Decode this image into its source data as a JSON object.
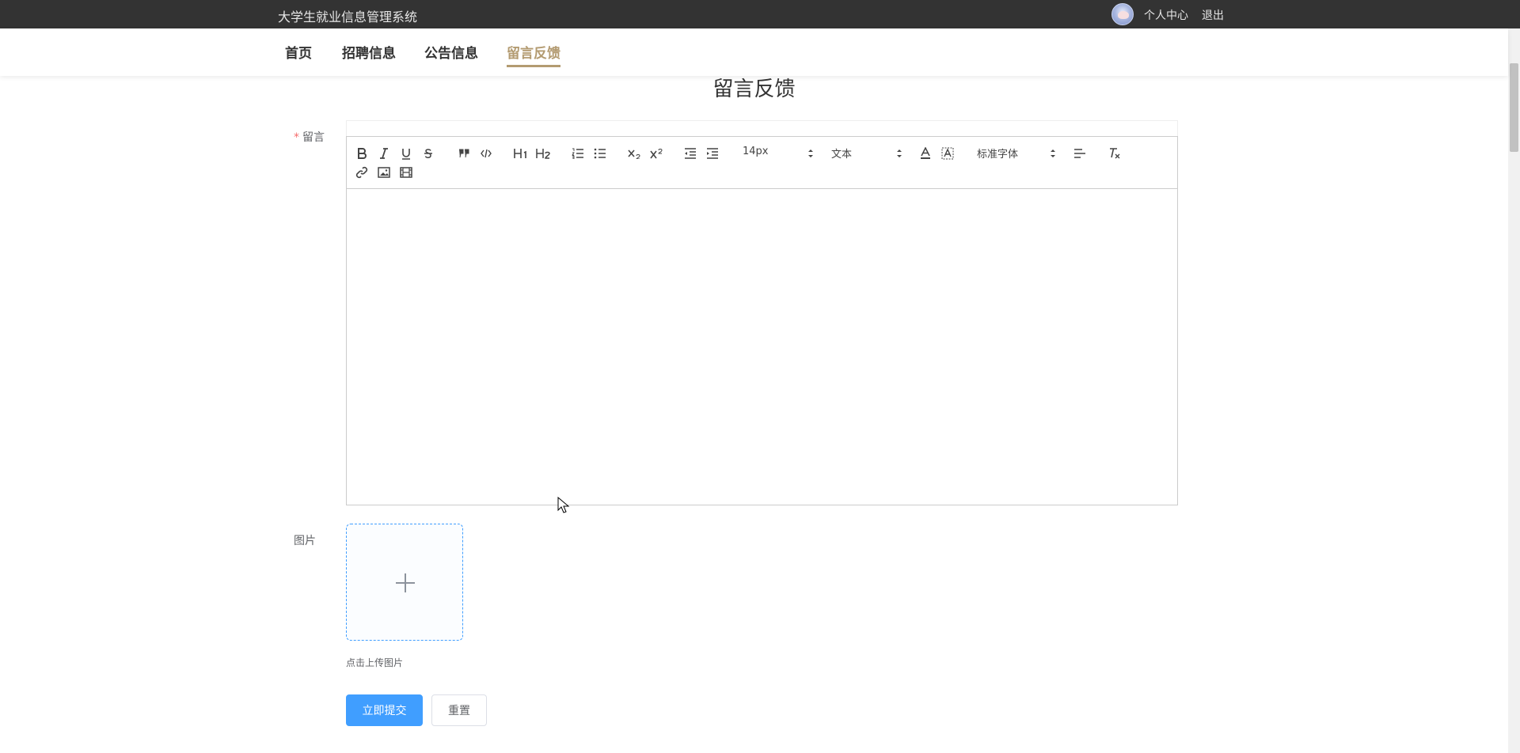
{
  "header": {
    "site_title": "大学生就业信息管理系统",
    "profile_link": "个人中心",
    "logout_link": "退出"
  },
  "nav": {
    "items": [
      "首页",
      "招聘信息",
      "公告信息",
      "留言反馈"
    ],
    "active": "留言反馈"
  },
  "page": {
    "heading": "留言反馈"
  },
  "form": {
    "message_label": "留言",
    "required_mark": "*",
    "editor": {
      "font_size_value": "14px",
      "header_value": "文本",
      "font_family_value": "标准字体",
      "content": ""
    },
    "image_label": "图片",
    "upload_tip": "点击上传图片",
    "submit_label": "立即提交",
    "reset_label": "重置"
  },
  "colors": {
    "topbar_bg": "#333333",
    "nav_active": "#b39b71",
    "primary": "#409eff"
  }
}
